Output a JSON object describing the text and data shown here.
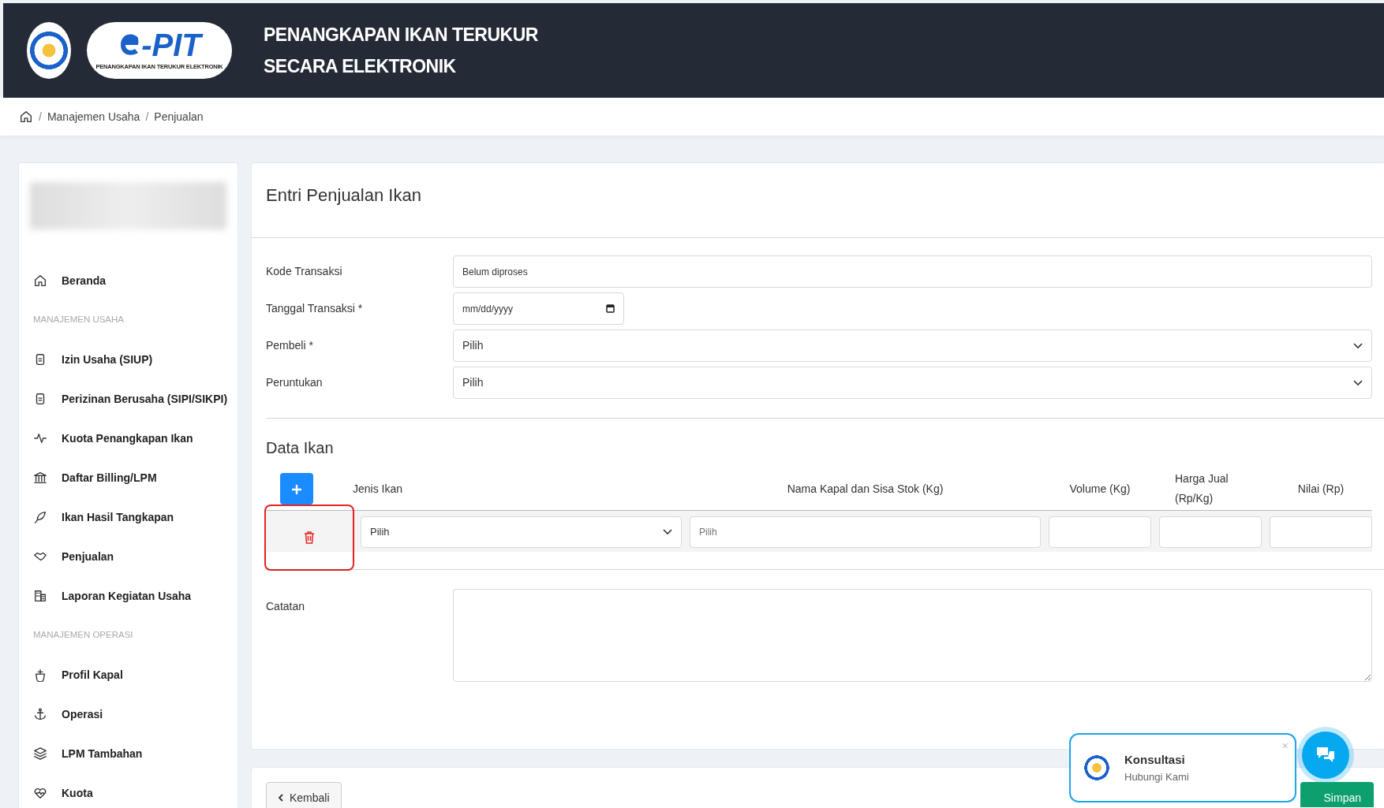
{
  "header": {
    "logo_text": "-PIT",
    "logo_tagline": "PENANGKAPAN IKAN TERUKUR ELEKTRONIK",
    "title_lines": [
      "PENANGKAPAN IKAN TERUKUR",
      "SECARA ELEKTRONIK"
    ]
  },
  "breadcrumb": [
    {
      "separator": "/",
      "label": "Manajemen Usaha"
    },
    {
      "separator": "/",
      "label": "Penjualan"
    }
  ],
  "sidebar": {
    "items": [
      {
        "kind": "link",
        "label": "Beranda"
      },
      {
        "kind": "section",
        "label": "MANAJEMEN USAHA"
      },
      {
        "kind": "link",
        "label": "Izin Usaha (SIUP)"
      },
      {
        "kind": "link",
        "label": "Perizinan Berusaha (SIPI/SIKPI)"
      },
      {
        "kind": "link",
        "label": "Kuota Penangkapan Ikan"
      },
      {
        "kind": "link",
        "label": "Daftar Billing/LPM"
      },
      {
        "kind": "link",
        "label": "Ikan Hasil Tangkapan"
      },
      {
        "kind": "link",
        "label": "Penjualan"
      },
      {
        "kind": "link",
        "label": "Laporan Kegiatan Usaha"
      },
      {
        "kind": "section",
        "label": "MANAJEMEN OPERASI"
      },
      {
        "kind": "link",
        "label": "Profil Kapal"
      },
      {
        "kind": "link",
        "label": "Operasi"
      },
      {
        "kind": "link",
        "label": "LPM Tambahan"
      },
      {
        "kind": "link",
        "label": "Kuota"
      }
    ]
  },
  "form": {
    "title": "Entri Penjualan Ikan",
    "fields": [
      {
        "kind": "text",
        "label": "Kode Transaksi",
        "value": "Belum diproses"
      },
      {
        "kind": "date",
        "label": "Tanggal Transaksi *",
        "placeholder": "mm/dd/yyyy"
      },
      {
        "kind": "select",
        "label": "Pembeli *",
        "value": "Pilih"
      },
      {
        "kind": "select",
        "label": "Peruntukan",
        "value": "Pilih"
      }
    ]
  },
  "data_ikan": {
    "title": "Data Ikan",
    "columns": [
      "Jenis Ikan",
      "Nama Kapal dan Sisa Stok (Kg)",
      "Volume (Kg)",
      "Harga Jual (Rp/Kg)",
      "Nilai (Rp)"
    ],
    "rows": [
      {
        "jenis_ikan": "Pilih",
        "nama_kapal_placeholder": "Pilih",
        "delete_highlighted": true
      }
    ]
  },
  "catatan": {
    "label": "Catatan"
  },
  "buttons": {
    "back": "Kembali",
    "save": "Simpan"
  },
  "chat": {
    "title": "Konsultasi",
    "subtitle": "Hubungi Kami",
    "close": "×"
  }
}
